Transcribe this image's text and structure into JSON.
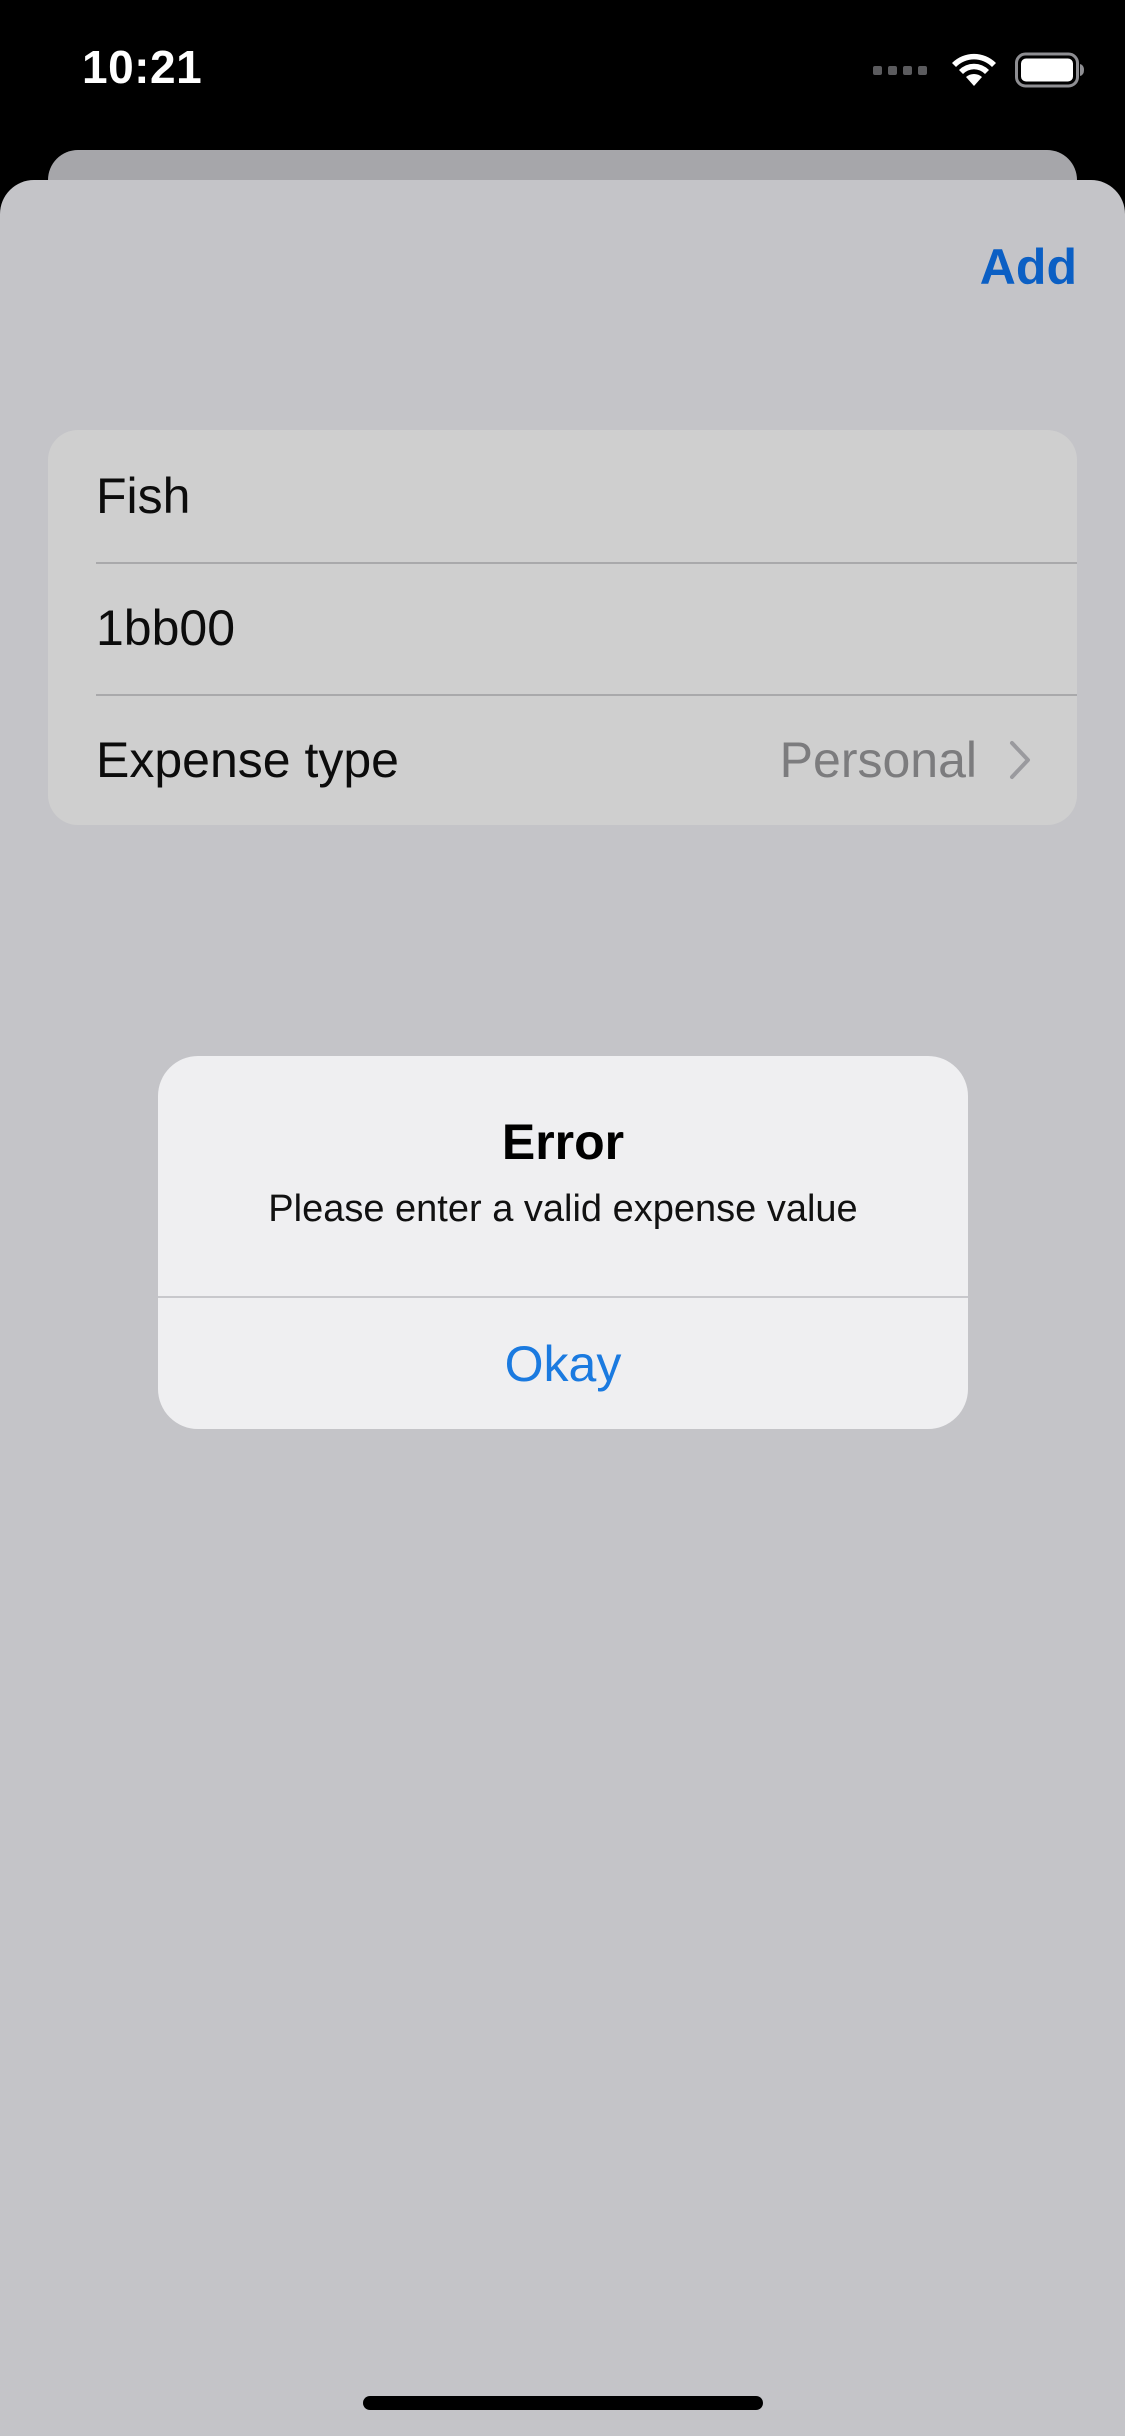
{
  "status_bar": {
    "time": "10:21",
    "icons": [
      "cellular-signal-icon",
      "wifi-icon",
      "battery-icon"
    ]
  },
  "sheet": {
    "add_label": "Add"
  },
  "form": {
    "name_value": "Fish",
    "amount_value": "1bb00",
    "expense_type_label": "Expense type",
    "expense_type_value": "Personal"
  },
  "alert": {
    "title": "Error",
    "message": "Please enter a valid expense value",
    "button_label": "Okay"
  },
  "colors": {
    "accent": "#1a7ae0",
    "add_button": "#0b5fc4",
    "sheet_background": "#c4c4c8",
    "alert_background": "#efeff1"
  }
}
